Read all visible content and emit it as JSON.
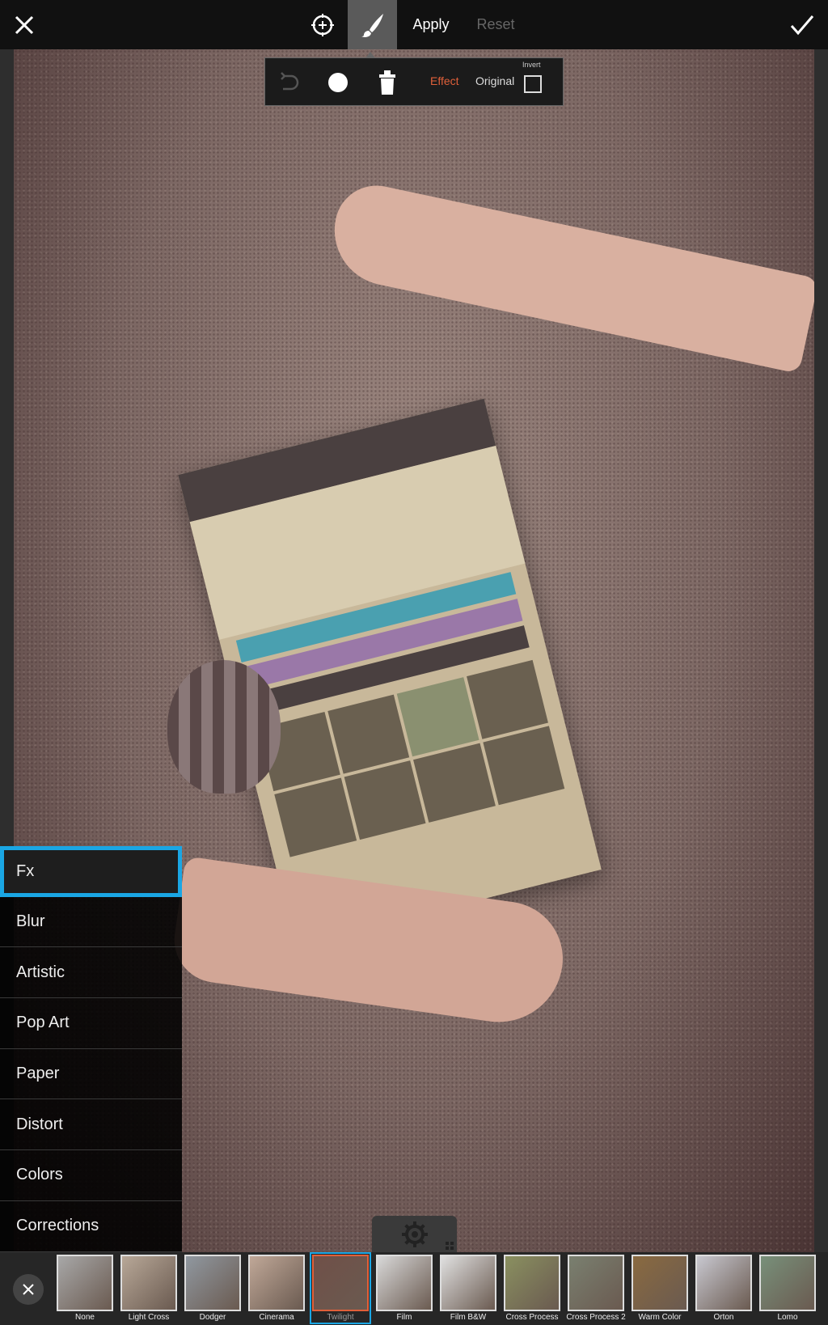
{
  "topbar": {
    "apply_label": "Apply",
    "reset_label": "Reset"
  },
  "brush_popup": {
    "effect_label": "Effect",
    "original_label": "Original",
    "invert_label": "Invert",
    "invert_checked": false,
    "active_mode": "Effect"
  },
  "colors": {
    "accent": "#1aa6e4",
    "effect_active": "#e0603a"
  },
  "categories": [
    {
      "label": "Fx",
      "selected": true
    },
    {
      "label": "Blur"
    },
    {
      "label": "Artistic"
    },
    {
      "label": "Pop Art"
    },
    {
      "label": "Paper"
    },
    {
      "label": "Distort"
    },
    {
      "label": "Colors"
    },
    {
      "label": "Corrections"
    }
  ],
  "effects": [
    {
      "label": "None",
      "tint": "#a8a8a8"
    },
    {
      "label": "Light Cross",
      "tint": "#b8a898"
    },
    {
      "label": "Dodger",
      "tint": "#9098a0"
    },
    {
      "label": "Cinerama",
      "tint": "#c0a898"
    },
    {
      "label": "Twilight",
      "tint": "#705048",
      "selected": true
    },
    {
      "label": "Film",
      "tint": "#d8d8d8"
    },
    {
      "label": "Film B&W",
      "tint": "#e0e0e0"
    },
    {
      "label": "Cross Process",
      "tint": "#8a9060"
    },
    {
      "label": "Cross Process 2",
      "tint": "#7a8070"
    },
    {
      "label": "Warm Color",
      "tint": "#8a6a40"
    },
    {
      "label": "Orton",
      "tint": "#c8c8d0"
    },
    {
      "label": "Lomo",
      "tint": "#78907a"
    }
  ]
}
